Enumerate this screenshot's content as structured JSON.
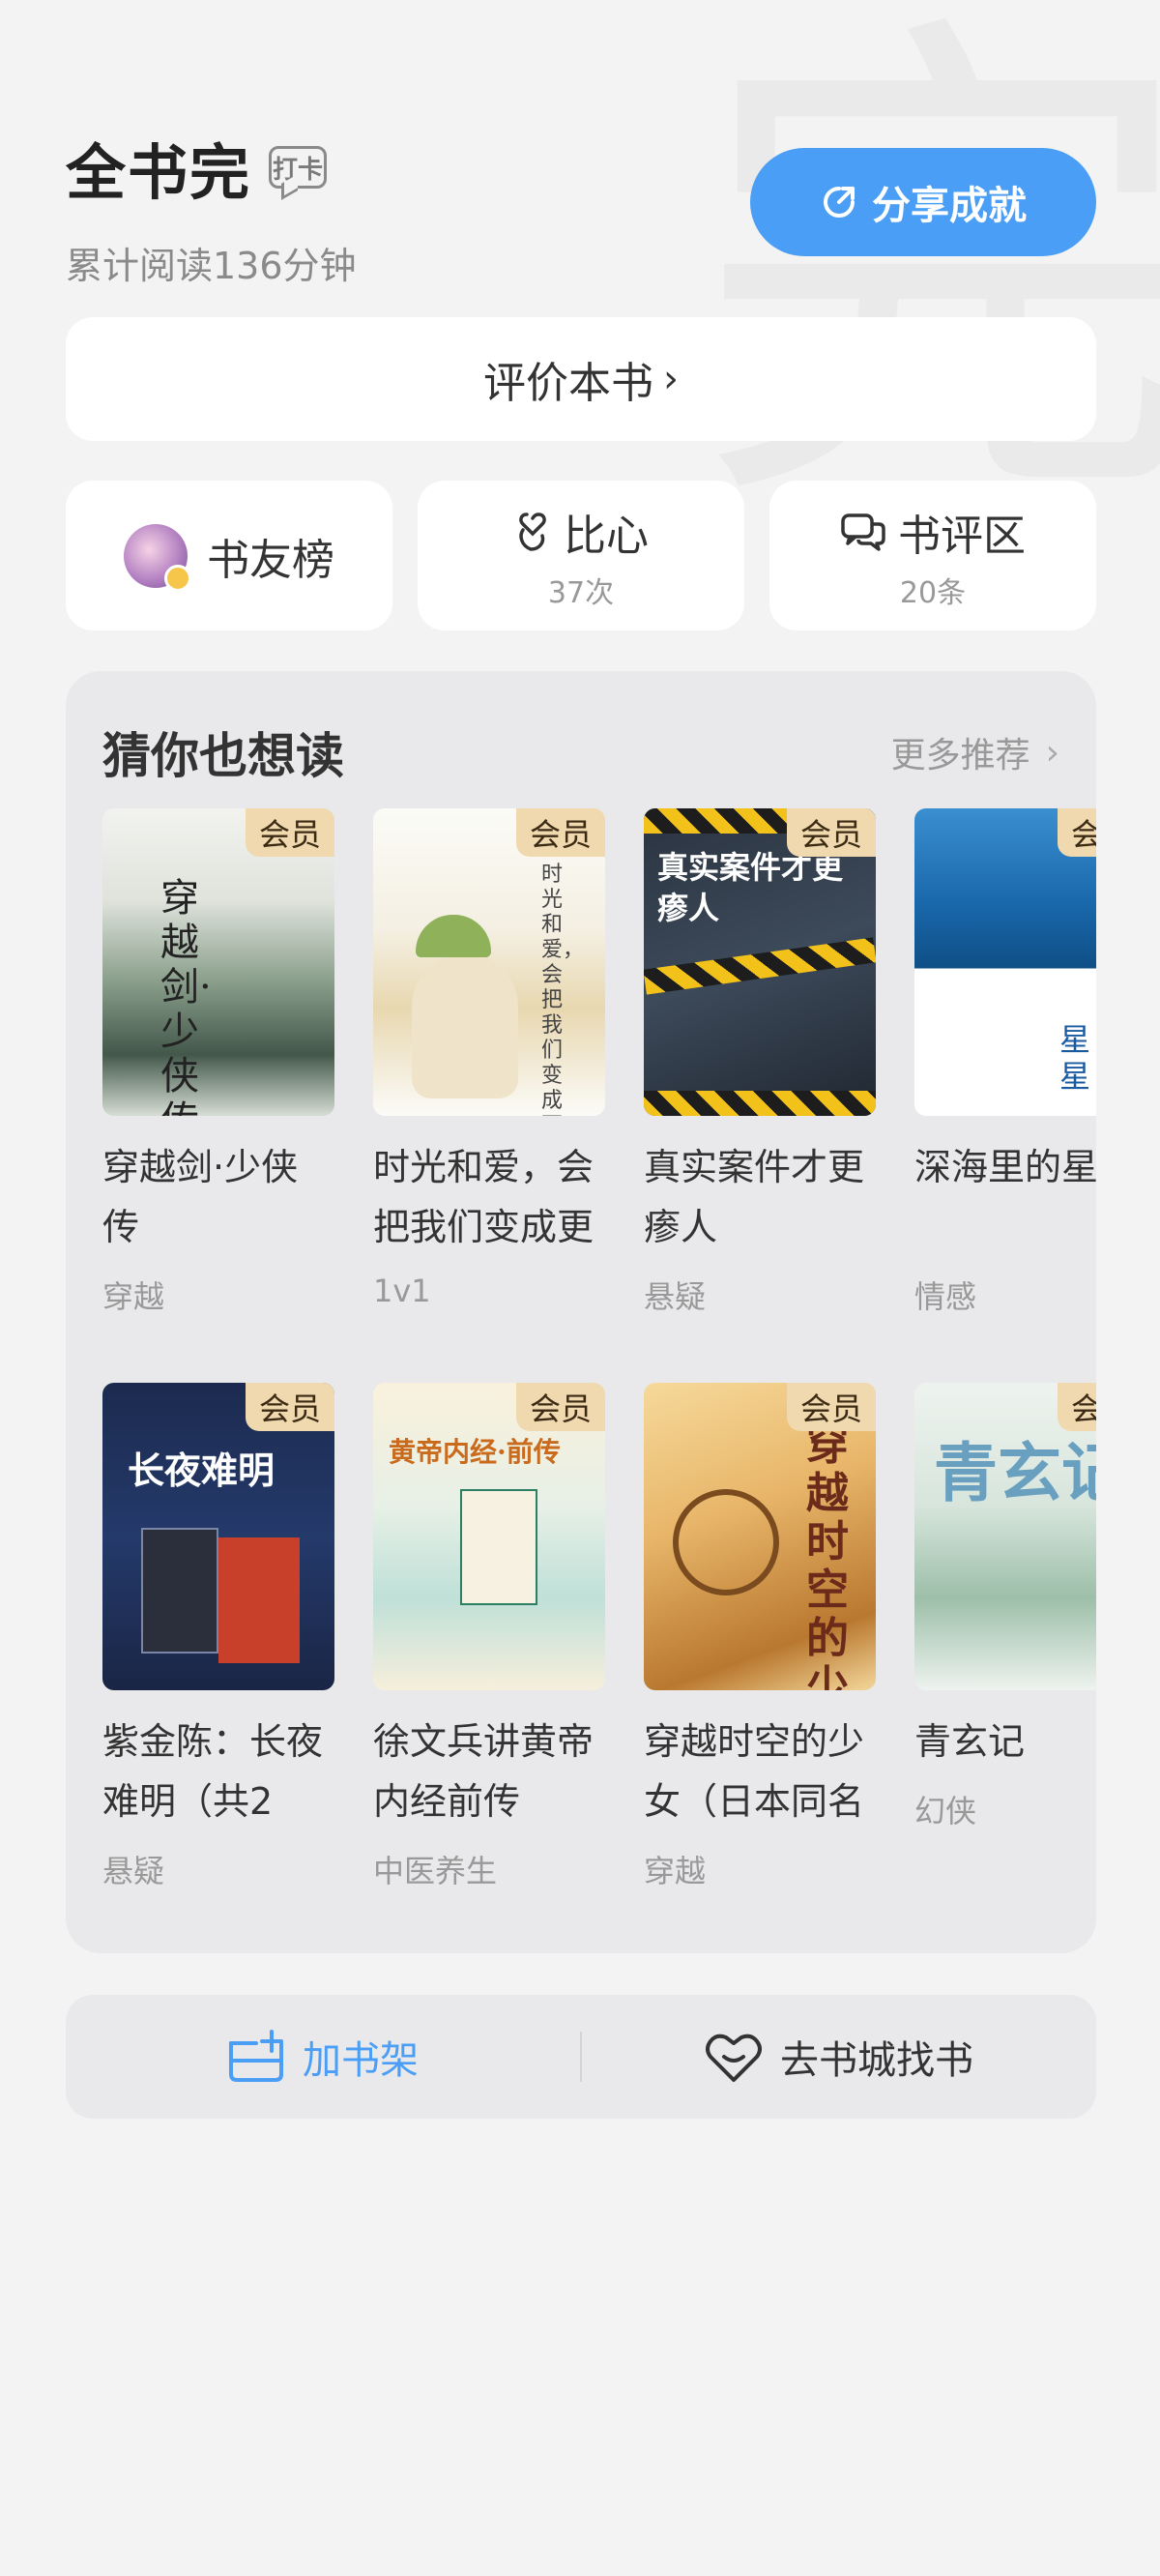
{
  "header": {
    "title": "全书完",
    "punch_label": "打卡",
    "read_time": "累计阅读136分钟",
    "share_label": "分享成就"
  },
  "rate": {
    "label": "评价本书",
    "chevron": "›"
  },
  "stats": {
    "ranking_label": "书友榜",
    "heart_label": "比心",
    "heart_count": "37次",
    "review_label": "书评区",
    "review_count": "20条"
  },
  "recommend": {
    "title": "猜你也想读",
    "more_label": "更多推荐",
    "vip_label": "会员",
    "books": [
      {
        "title": "穿越剑·少侠传",
        "tag": "穿越",
        "cover_text": "穿越剑·少侠传"
      },
      {
        "title": "时光和爱，会把我们变成更",
        "tag": "1v1",
        "cover_text": "时光和爱，会把我们变成更好的人"
      },
      {
        "title": "真实案件才更瘆人",
        "tag": "悬疑",
        "cover_text": "真实案件才更瘆人"
      },
      {
        "title": "深海里的星星",
        "tag": "情感",
        "cover_text": "星星"
      },
      {
        "title": "紫金陈：长夜难明（共2",
        "tag": "悬疑",
        "cover_text": "长夜难明"
      },
      {
        "title": "徐文兵讲黄帝内经前传",
        "tag": "中医养生",
        "cover_text": "黄帝内经·前传"
      },
      {
        "title": "穿越时空的少女（日本同名",
        "tag": "穿越",
        "cover_text": "穿越时空的少女"
      },
      {
        "title": "青玄记",
        "tag": "幻侠",
        "cover_text": "青玄记"
      }
    ]
  },
  "bottom": {
    "add_shelf_label": "加书架",
    "go_store_label": "去书城找书"
  },
  "colors": {
    "accent": "#4a9ef5",
    "vip_badge": "#f0d9ae",
    "background": "#f3f3f4"
  },
  "icons": {
    "share": "share-icon",
    "heart": "finger-heart-icon",
    "review": "chat-bubbles-icon",
    "add_shelf": "add-shelf-icon",
    "store": "heart-bag-icon"
  }
}
